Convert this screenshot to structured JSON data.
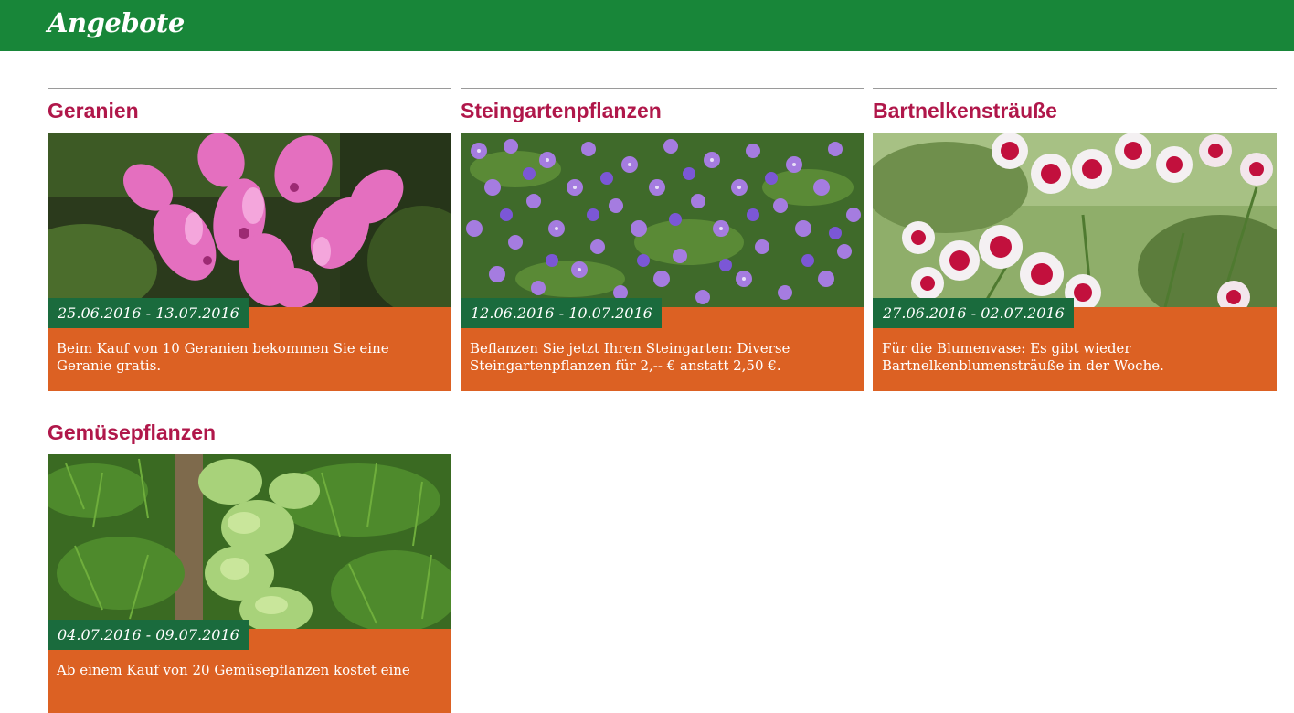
{
  "header": {
    "title": "Angebote"
  },
  "offers": [
    {
      "title": "Geranien",
      "date": "25.06.2016 - 13.07.2016",
      "description": "Beim Kauf von 10 Geranien bekommen Sie eine Geranie gratis.",
      "image": "geranium-photo"
    },
    {
      "title": "Steingartenpflanzen",
      "date": "12.06.2016 - 10.07.2016",
      "description": "Beflanzen Sie jetzt Ihren Steingarten: Diverse Steingartenpflanzen für 2,-- € anstatt 2,50 €.",
      "image": "rock-garden-photo"
    },
    {
      "title": "Bartnelkensträuße",
      "date": "27.06.2016 - 02.07.2016",
      "description": "Für die Blumenvase: Es gibt wieder Bartnelkenblumensträuße in der Woche.",
      "image": "sweet-william-photo"
    },
    {
      "title": "Gemüsepflanzen",
      "date": "04.07.2016 - 09.07.2016",
      "description": "Ab einem Kauf von 20 Gemüsepflanzen kostet eine",
      "image": "vegetable-plants-photo"
    }
  ],
  "colors": {
    "header_bg": "#188639",
    "title_color": "#b0174a",
    "date_badge_bg": "#1a6b3d",
    "card_body_bg": "#dc6123"
  }
}
